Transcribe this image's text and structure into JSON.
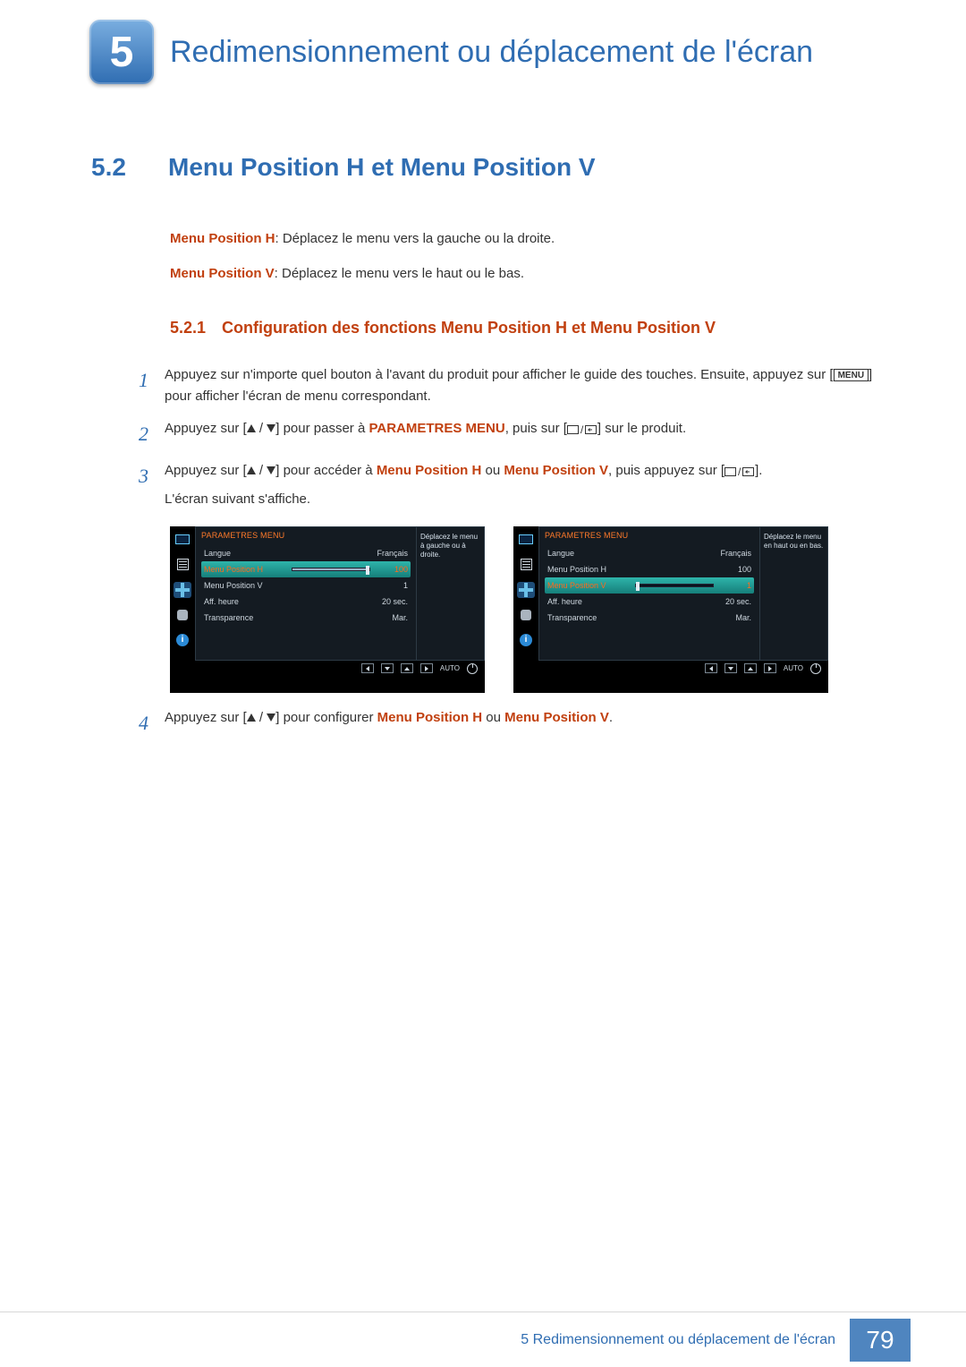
{
  "chapter": {
    "number": "5",
    "title": "Redimensionnement ou déplacement de l'écran"
  },
  "section": {
    "number": "5.2",
    "title": "Menu Position H et Menu Position V"
  },
  "definitions": {
    "h_label": "Menu Position H",
    "h_text": ": Déplacez le menu vers la gauche ou la droite.",
    "v_label": "Menu Position V",
    "v_text": ": Déplacez le menu vers le haut ou le bas."
  },
  "subsection": {
    "number": "5.2.1",
    "title": "Configuration des fonctions Menu Position H et Menu Position V"
  },
  "steps": {
    "s1": {
      "num": "1",
      "a": "Appuyez sur n'importe quel bouton à l'avant du produit pour afficher le guide des touches. Ensuite, appuyez sur [",
      "menu": "MENU",
      "b": "] pour afficher l'écran de menu correspondant."
    },
    "s2": {
      "num": "2",
      "a": "Appuyez sur [",
      "b": "] pour passer à ",
      "param": "PARAMETRES MENU",
      "c": ", puis sur [",
      "d": "] sur le produit."
    },
    "s3": {
      "num": "3",
      "a": "Appuyez sur [",
      "b": "] pour accéder à ",
      "mh": "Menu Position H",
      "ou": " ou ",
      "mv": "Menu Position V",
      "c": ", puis appuyez sur [",
      "d": "].",
      "e": "L'écran suivant s'affiche."
    },
    "s4": {
      "num": "4",
      "a": "Appuyez sur [",
      "b": "] pour configurer ",
      "mh": "Menu Position H",
      "ou": " ou ",
      "mv": "Menu Position V",
      "c": "."
    }
  },
  "osd": {
    "title": "PARAMETRES MENU",
    "tooltip_left": "Déplacez le menu à gauche ou à droite.",
    "tooltip_right": "Déplacez le menu en haut ou en bas.",
    "rows": {
      "langue": {
        "label": "Langue",
        "value": "Français"
      },
      "menu_h": {
        "label": "Menu Position H",
        "value": "100",
        "fill": 100
      },
      "menu_v": {
        "label": "Menu Position V",
        "value": "1",
        "fill": 2
      },
      "aff": {
        "label": "Aff. heure",
        "value": "20 sec."
      },
      "transp": {
        "label": "Transparence",
        "value": "Mar."
      }
    },
    "auto": "AUTO"
  },
  "chart_data": [
    {
      "type": "table",
      "title": "PARAMETRES MENU",
      "selected_row": "Menu Position H",
      "tooltip": "Déplacez le menu à gauche ou à droite.",
      "rows": [
        {
          "label": "Langue",
          "value": "Français"
        },
        {
          "label": "Menu Position H",
          "value": 100,
          "slider_percent": 100
        },
        {
          "label": "Menu Position V",
          "value": 1
        },
        {
          "label": "Aff. heure",
          "value": "20 sec."
        },
        {
          "label": "Transparence",
          "value": "Mar."
        }
      ]
    },
    {
      "type": "table",
      "title": "PARAMETRES MENU",
      "selected_row": "Menu Position V",
      "tooltip": "Déplacez le menu en haut ou en bas.",
      "rows": [
        {
          "label": "Langue",
          "value": "Français"
        },
        {
          "label": "Menu Position H",
          "value": 100
        },
        {
          "label": "Menu Position V",
          "value": 1,
          "slider_percent": 2
        },
        {
          "label": "Aff. heure",
          "value": "20 sec."
        },
        {
          "label": "Transparence",
          "value": "Mar."
        }
      ]
    }
  ],
  "footer": {
    "text": "5 Redimensionnement ou déplacement de l'écran",
    "page": "79"
  }
}
